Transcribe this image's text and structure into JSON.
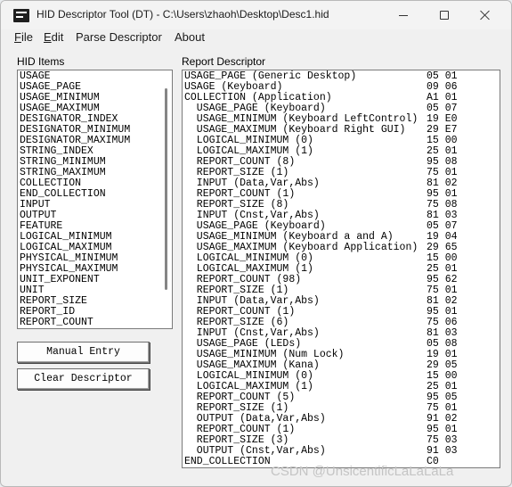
{
  "window": {
    "title": "HID Descriptor Tool (DT) - C:\\Users\\zhaoh\\Desktop\\Desc1.hid",
    "icon": "hid-tool-app-icon"
  },
  "menu": {
    "file": "File",
    "edit": "Edit",
    "parse": "Parse Descriptor",
    "about": "About"
  },
  "hid_items": {
    "label": "HID Items",
    "items": [
      "USAGE",
      "USAGE_PAGE",
      "USAGE_MINIMUM",
      "USAGE_MAXIMUM",
      "DESIGNATOR_INDEX",
      "DESIGNATOR_MINIMUM",
      "DESIGNATOR_MAXIMUM",
      "STRING_INDEX",
      "STRING_MINIMUM",
      "STRING_MAXIMUM",
      "COLLECTION",
      "END_COLLECTION",
      "INPUT",
      "OUTPUT",
      "FEATURE",
      "LOGICAL_MINIMUM",
      "LOGICAL_MAXIMUM",
      "PHYSICAL_MINIMUM",
      "PHYSICAL_MAXIMUM",
      "UNIT_EXPONENT",
      "UNIT",
      "REPORT_SIZE",
      "REPORT_ID",
      "REPORT_COUNT"
    ]
  },
  "buttons": {
    "manual_entry": "Manual Entry",
    "clear_descriptor": "Clear Descriptor"
  },
  "report_descriptor": {
    "label": "Report Descriptor",
    "lines": [
      {
        "text": "USAGE_PAGE (Generic Desktop)",
        "hex": "05 01"
      },
      {
        "text": "USAGE (Keyboard)",
        "hex": "09 06"
      },
      {
        "text": "COLLECTION (Application)",
        "hex": "A1 01"
      },
      {
        "text": "  USAGE_PAGE (Keyboard)",
        "hex": "05 07"
      },
      {
        "text": "  USAGE_MINIMUM (Keyboard LeftControl)",
        "hex": "19 E0"
      },
      {
        "text": "  USAGE_MAXIMUM (Keyboard Right GUI)",
        "hex": "29 E7"
      },
      {
        "text": "  LOGICAL_MINIMUM (0)",
        "hex": "15 00"
      },
      {
        "text": "  LOGICAL_MAXIMUM (1)",
        "hex": "25 01"
      },
      {
        "text": "  REPORT_COUNT (8)",
        "hex": "95 08"
      },
      {
        "text": "  REPORT_SIZE (1)",
        "hex": "75 01"
      },
      {
        "text": "  INPUT (Data,Var,Abs)",
        "hex": "81 02"
      },
      {
        "text": "  REPORT_COUNT (1)",
        "hex": "95 01"
      },
      {
        "text": "  REPORT_SIZE (8)",
        "hex": "75 08"
      },
      {
        "text": "  INPUT (Cnst,Var,Abs)",
        "hex": "81 03"
      },
      {
        "text": "  USAGE_PAGE (Keyboard)",
        "hex": "05 07"
      },
      {
        "text": "  USAGE_MINIMUM (Keyboard a and A)",
        "hex": "19 04"
      },
      {
        "text": "  USAGE_MAXIMUM (Keyboard Application)",
        "hex": "29 65"
      },
      {
        "text": "  LOGICAL_MINIMUM (0)",
        "hex": "15 00"
      },
      {
        "text": "  LOGICAL_MAXIMUM (1)",
        "hex": "25 01"
      },
      {
        "text": "  REPORT_COUNT (98)",
        "hex": "95 62"
      },
      {
        "text": "  REPORT_SIZE (1)",
        "hex": "75 01"
      },
      {
        "text": "  INPUT (Data,Var,Abs)",
        "hex": "81 02"
      },
      {
        "text": "  REPORT_COUNT (1)",
        "hex": "95 01"
      },
      {
        "text": "  REPORT_SIZE (6)",
        "hex": "75 06"
      },
      {
        "text": "  INPUT (Cnst,Var,Abs)",
        "hex": "81 03"
      },
      {
        "text": "  USAGE_PAGE (LEDs)",
        "hex": "05 08"
      },
      {
        "text": "  USAGE_MINIMUM (Num Lock)",
        "hex": "19 01"
      },
      {
        "text": "  USAGE_MAXIMUM (Kana)",
        "hex": "29 05"
      },
      {
        "text": "  LOGICAL_MINIMUM (0)",
        "hex": "15 00"
      },
      {
        "text": "  LOGICAL_MAXIMUM (1)",
        "hex": "25 01"
      },
      {
        "text": "  REPORT_COUNT (5)",
        "hex": "95 05"
      },
      {
        "text": "  REPORT_SIZE (1)",
        "hex": "75 01"
      },
      {
        "text": "  OUTPUT (Data,Var,Abs)",
        "hex": "91 02"
      },
      {
        "text": "  REPORT_COUNT (1)",
        "hex": "95 01"
      },
      {
        "text": "  REPORT_SIZE (3)",
        "hex": "75 03"
      },
      {
        "text": "  OUTPUT (Cnst,Var,Abs)",
        "hex": "91 03"
      },
      {
        "text": "END_COLLECTION",
        "hex": "C0"
      }
    ]
  },
  "watermark": "CSDN @UnsicentificLaLaLaLa"
}
